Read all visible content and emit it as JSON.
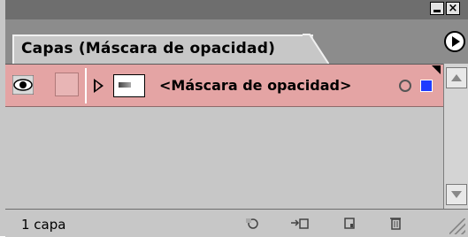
{
  "window": {
    "minimize_icon": "minimize-icon",
    "close_symbol": "×"
  },
  "tab": {
    "label": "Capas (Máscara de opacidad)"
  },
  "layer": {
    "name": "<Máscara de opacidad>",
    "row_color": "#e4a4a4"
  },
  "status": {
    "count_text": "1 capa"
  },
  "footer_icons": [
    "new-effect-icon",
    "clip-layer-icon",
    "new-layer-icon",
    "trash-icon"
  ]
}
